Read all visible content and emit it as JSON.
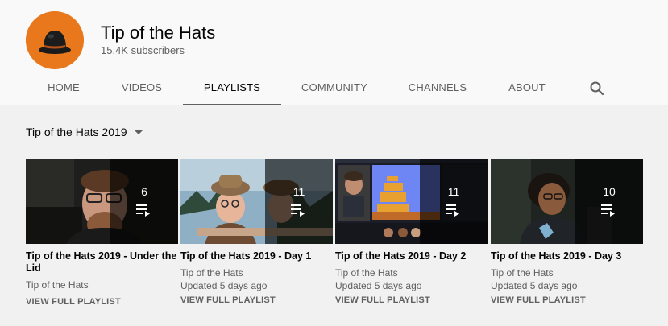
{
  "channel": {
    "name": "Tip of the Hats",
    "subscribers": "15.4K subscribers",
    "avatar_icon": "bowler-hat-icon",
    "avatar_color": "#e9781c"
  },
  "tabs": [
    {
      "label": "HOME"
    },
    {
      "label": "VIDEOS"
    },
    {
      "label": "PLAYLISTS",
      "active": true
    },
    {
      "label": "COMMUNITY"
    },
    {
      "label": "CHANNELS"
    },
    {
      "label": "ABOUT"
    }
  ],
  "search_icon": "search-icon",
  "section": {
    "title": "Tip of the Hats 2019",
    "dropdown_icon": "caret-down-icon"
  },
  "playlists": [
    {
      "title": "Tip of the Hats 2019 - Under the Lid",
      "channel": "Tip of the Hats",
      "updated": "",
      "count": "6",
      "action": "VIEW FULL PLAYLIST"
    },
    {
      "title": "Tip of the Hats 2019 - Day 1",
      "channel": "Tip of the Hats",
      "updated": "Updated 5 days ago",
      "count": "11",
      "action": "VIEW FULL PLAYLIST"
    },
    {
      "title": "Tip of the Hats 2019 - Day 2",
      "channel": "Tip of the Hats",
      "updated": "Updated 5 days ago",
      "count": "11",
      "action": "VIEW FULL PLAYLIST"
    },
    {
      "title": "Tip of the Hats 2019 - Day 3",
      "channel": "Tip of the Hats",
      "updated": "Updated 5 days ago",
      "count": "10",
      "action": "VIEW FULL PLAYLIST"
    }
  ],
  "playlist_icon": "playlist-icon",
  "colors": {
    "header_bg": "#f9f9f9",
    "page_bg": "#f1f1f1",
    "text_primary": "#030303",
    "text_secondary": "#606060"
  }
}
